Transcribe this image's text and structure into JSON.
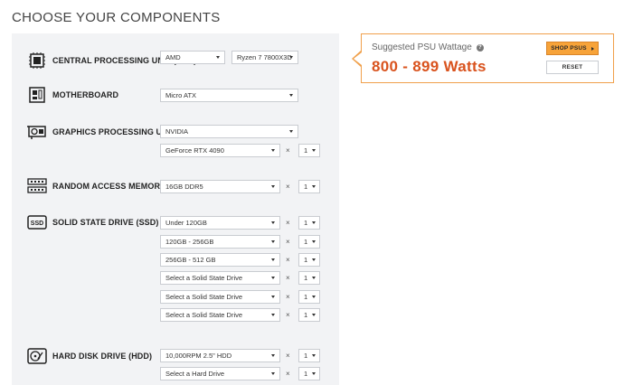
{
  "page_title": "CHOOSE YOUR COMPONENTS",
  "components": {
    "cpu": {
      "label": "CENTRAL PROCESSING UNIT (CPU)",
      "brand": "AMD",
      "model": "Ryzen 7 7800X3D"
    },
    "motherboard": {
      "label": "MOTHERBOARD",
      "form_factor": "Micro ATX"
    },
    "gpu": {
      "label": "GRAPHICS PROCESSING UNIT (GPU)",
      "brand": "NVIDIA",
      "model": "GeForce RTX 4090",
      "qty": "1"
    },
    "ram": {
      "label": "RANDOM ACCESS MEMORY (RAM)",
      "type": "16GB DDR5",
      "qty": "1"
    },
    "ssd": {
      "label": "SOLID STATE DRIVE (SSD)",
      "icon_text": "SSD",
      "drives": [
        {
          "value": "Under 120GB",
          "qty": "1"
        },
        {
          "value": "120GB - 256GB",
          "qty": "1"
        },
        {
          "value": "256GB - 512 GB",
          "qty": "1"
        },
        {
          "value": "Select a Solid State Drive",
          "qty": "1"
        },
        {
          "value": "Select a Solid State Drive",
          "qty": "1"
        },
        {
          "value": "Select a Solid State Drive",
          "qty": "1"
        }
      ]
    },
    "hdd": {
      "label": "HARD DISK DRIVE (HDD)",
      "drives": [
        {
          "value": "10,000RPM 2.5\" HDD",
          "qty": "1"
        },
        {
          "value": "Select a Hard Drive",
          "qty": "1"
        }
      ]
    },
    "times_symbol": "×"
  },
  "psu": {
    "label": "Suggested PSU Wattage",
    "help_symbol": "?",
    "watts": "800 - 899 Watts",
    "shop_label": "SHOP PSUS",
    "reset_label": "RESET"
  },
  "colors": {
    "accent": "#d9531e",
    "button": "#f7a339",
    "panel": "#f2f3f5",
    "border": "#f0a04b"
  }
}
